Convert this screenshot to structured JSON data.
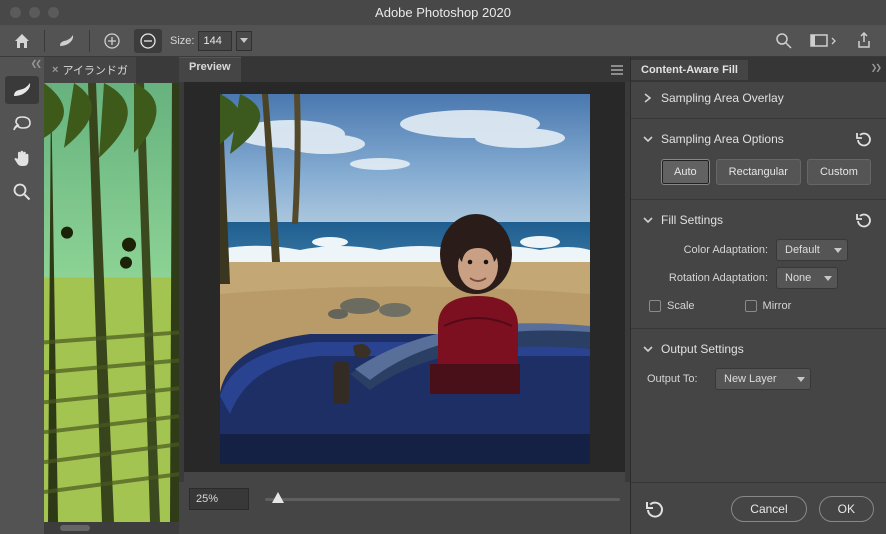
{
  "window": {
    "title": "Adobe Photoshop 2020"
  },
  "optionsBar": {
    "sizeLabel": "Size:",
    "sizeValue": "144"
  },
  "document": {
    "tabName": "アイランドガ"
  },
  "previewPanel": {
    "title": "Preview",
    "zoomValue": "25%"
  },
  "cafPanel": {
    "title": "Content-Aware Fill",
    "samplingAreaOverlay": {
      "label": "Sampling Area Overlay"
    },
    "samplingAreaOptions": {
      "label": "Sampling Area Options",
      "buttons": {
        "auto": "Auto",
        "rectangular": "Rectangular",
        "custom": "Custom"
      },
      "selected": "Auto"
    },
    "fillSettings": {
      "label": "Fill Settings",
      "colorAdaptationLabel": "Color Adaptation:",
      "colorAdaptationValue": "Default",
      "rotationAdaptationLabel": "Rotation Adaptation:",
      "rotationAdaptationValue": "None",
      "scaleLabel": "Scale",
      "mirrorLabel": "Mirror"
    },
    "outputSettings": {
      "label": "Output Settings",
      "outputToLabel": "Output To:",
      "outputToValue": "New Layer"
    },
    "footer": {
      "cancel": "Cancel",
      "ok": "OK"
    }
  }
}
